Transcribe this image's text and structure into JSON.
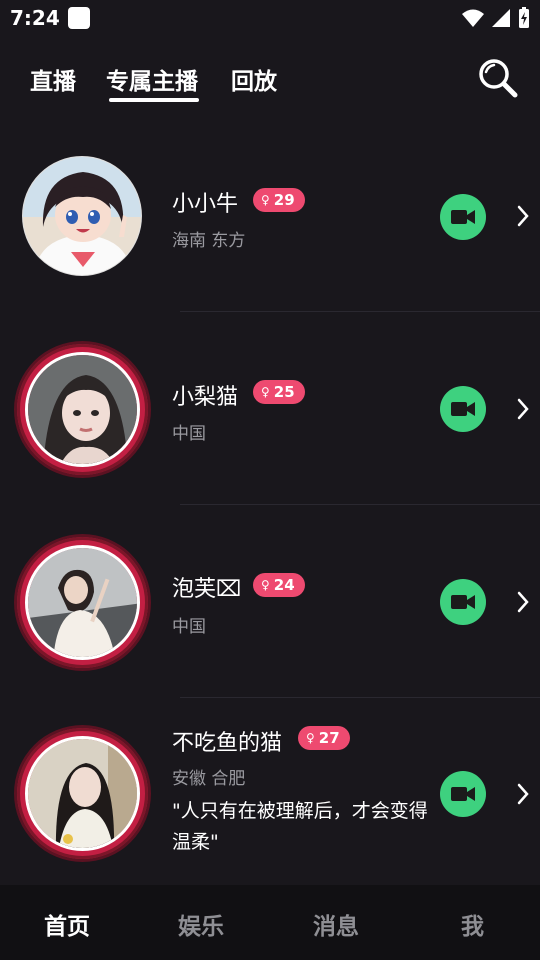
{
  "status_bar": {
    "time": "7:24"
  },
  "tabs": [
    {
      "label": "直播",
      "active": false
    },
    {
      "label": "专属主播",
      "active": true
    },
    {
      "label": "回放",
      "active": false
    }
  ],
  "hosts": [
    {
      "name": "小小牛",
      "age": "29",
      "location": "海南 东方",
      "signature": ""
    },
    {
      "name": "小梨猫",
      "age": "25",
      "location": "中国",
      "signature": ""
    },
    {
      "name": "泡芙⌧",
      "age": "24",
      "location": "中国",
      "signature": ""
    },
    {
      "name": "不吃鱼的猫",
      "age": "27",
      "location": "安徽 合肥",
      "signature": "\"人只有在被理解后，才会变得温柔\""
    }
  ],
  "bottom_nav": [
    {
      "label": "首页",
      "active": true
    },
    {
      "label": "娱乐",
      "active": false
    },
    {
      "label": "消息",
      "active": false
    },
    {
      "label": "我",
      "active": false
    }
  ],
  "colors": {
    "accent_pink": "#ee4a70",
    "video_green": "#3ed17f",
    "ring_red": "#c31f43",
    "background": "#19171c"
  },
  "icons": {
    "search": "search-icon",
    "video": "video-camera-icon",
    "chevron": "chevron-right-icon",
    "gender": "female-icon"
  }
}
